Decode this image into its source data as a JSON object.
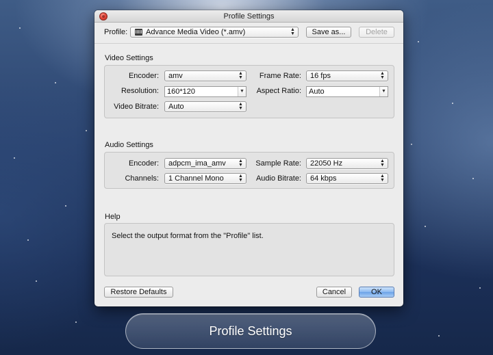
{
  "window": {
    "title": "Profile Settings"
  },
  "profile": {
    "label": "Profile:",
    "value": "Advance Media Video (*.amv)",
    "save_as_label": "Save as...",
    "delete_label": "Delete"
  },
  "video": {
    "section_title": "Video Settings",
    "encoder_label": "Encoder:",
    "encoder_value": "amv",
    "frame_rate_label": "Frame Rate:",
    "frame_rate_value": "16 fps",
    "resolution_label": "Resolution:",
    "resolution_value": "160*120",
    "aspect_ratio_label": "Aspect Ratio:",
    "aspect_ratio_value": "Auto",
    "bitrate_label": "Video Bitrate:",
    "bitrate_value": "Auto"
  },
  "audio": {
    "section_title": "Audio Settings",
    "encoder_label": "Encoder:",
    "encoder_value": "adpcm_ima_amv",
    "sample_rate_label": "Sample Rate:",
    "sample_rate_value": "22050 Hz",
    "channels_label": "Channels:",
    "channels_value": "1 Channel Mono",
    "bitrate_label": "Audio Bitrate:",
    "bitrate_value": "64 kbps"
  },
  "help": {
    "section_title": "Help",
    "text": "Select the output format from the \"Profile\" list."
  },
  "buttons": {
    "restore_defaults": "Restore Defaults",
    "cancel": "Cancel",
    "ok": "OK"
  },
  "caption": {
    "text": "Profile Settings"
  },
  "icons": {
    "close": "close-icon",
    "popup_arrows": "updown-arrows-icon",
    "combo_arrow": "chevron-down-icon",
    "profile_format": "film-icon"
  },
  "colors": {
    "default_button": "#6aa2e7",
    "close_button": "#e54a3c"
  }
}
